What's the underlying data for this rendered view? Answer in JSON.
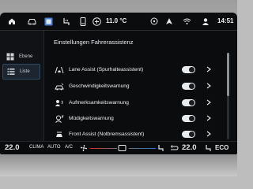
{
  "status_bar": {
    "icons": [
      "home-icon",
      "car-icon",
      "apps-icon",
      "seat-heating-icon",
      "phone-icon",
      "add-icon",
      "media-icon",
      "navigation-icon",
      "wifi-icon",
      "profile-icon"
    ],
    "temperature": "11.0 °C",
    "time": "14:51"
  },
  "sidebar": {
    "items": [
      {
        "icon": "grid-view-icon",
        "label": "Ebene"
      },
      {
        "icon": "list-view-icon",
        "label": "Liste"
      }
    ],
    "selected": "Liste"
  },
  "main": {
    "title": "Einstellungen Fahrerassistenz",
    "rows": [
      {
        "icon": "lane-assist-icon",
        "label": "Lane Assist (Spurhalteassistent)",
        "enabled": true
      },
      {
        "icon": "speed-warning-icon",
        "label": "Geschwindigkeitswarnung",
        "enabled": true
      },
      {
        "icon": "attention-icon",
        "label": "Aufmerksamkeitswarnung",
        "enabled": true
      },
      {
        "icon": "fatigue-icon",
        "label": "Müdigkeitswarnung",
        "enabled": true
      },
      {
        "icon": "front-assist-icon",
        "label": "Front Assist (Notbremsassistent)",
        "enabled": true
      }
    ]
  },
  "climate": {
    "temp_left": "22.0",
    "temp_right": "22.0",
    "clima": "CLIMA",
    "auto": "AUTO",
    "ac": "A/C",
    "eco": "ECO"
  },
  "colors": {
    "screen_bg": "#0b0c0e",
    "sidebar_selected": "#1d2630",
    "toggle_on": "#e9ecef",
    "fan_red": "#d12a2a",
    "fan_blue": "#2b6fd1"
  }
}
